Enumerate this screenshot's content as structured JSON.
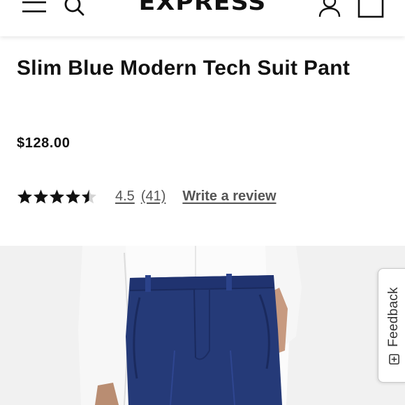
{
  "header": {
    "logo": "EXPRESS",
    "icons": [
      "menu-icon",
      "search-icon",
      "account-icon",
      "bag-icon"
    ]
  },
  "product": {
    "title": "Slim Blue Modern Tech Suit Pant",
    "price": "$128.00",
    "rating": {
      "value": "4.5",
      "count": "(41)",
      "stars": 4.5,
      "write_review": "Write a review"
    }
  },
  "feedback": {
    "label": "Feedback",
    "icon": "feedback-icon"
  },
  "colors": {
    "text": "#111111",
    "muted": "#555555",
    "image_bg": "#f1f1f1",
    "pant_blue": "#253a78",
    "shirt": "#ffffff"
  }
}
